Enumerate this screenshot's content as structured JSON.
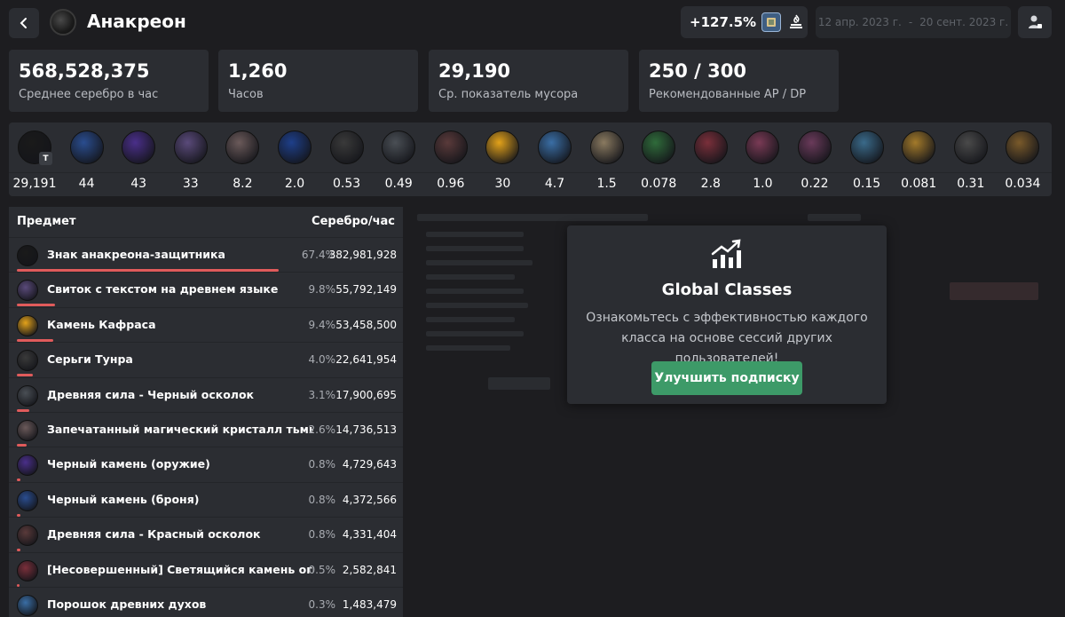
{
  "header": {
    "back_icon": "chevron-left-icon",
    "title": "Анакреон",
    "change_percent": "+127.5%",
    "date_from": "12 апр. 2023 г.",
    "date_separator": "-",
    "date_to": "20 сент. 2023 г."
  },
  "stats": [
    {
      "value": "568,528,375",
      "label": "Среднее серебро в час"
    },
    {
      "value": "1,260",
      "label": "Часов"
    },
    {
      "value": "29,190",
      "label": "Ср. показатель мусора"
    },
    {
      "value": "250 / 300",
      "label": "Рекомендованные AP / DP"
    }
  ],
  "strip": {
    "badge": "T",
    "items": [
      {
        "value": "29,191",
        "color": "#1a1a1a"
      },
      {
        "value": "44",
        "color": "#2a4d8f"
      },
      {
        "value": "43",
        "color": "#4a2f8a"
      },
      {
        "value": "33",
        "color": "#5a4a7a"
      },
      {
        "value": "8.2",
        "color": "#6b5a5a"
      },
      {
        "value": "2.0",
        "color": "#1e3f8a"
      },
      {
        "value": "0.53",
        "color": "#3a3a3a"
      },
      {
        "value": "0.49",
        "color": "#4a4f55"
      },
      {
        "value": "0.96",
        "color": "#5a3a3a"
      },
      {
        "value": "30",
        "color": "#e3a21a"
      },
      {
        "value": "4.7",
        "color": "#3a6ea5"
      },
      {
        "value": "1.5",
        "color": "#8a7a60"
      },
      {
        "value": "0.078",
        "color": "#2f6b3a"
      },
      {
        "value": "2.8",
        "color": "#7a2f3a"
      },
      {
        "value": "1.0",
        "color": "#7a3a55"
      },
      {
        "value": "0.22",
        "color": "#6a3a5a"
      },
      {
        "value": "0.15",
        "color": "#3a6a8a"
      },
      {
        "value": "0.081",
        "color": "#a37a2a"
      },
      {
        "value": "0.31",
        "color": "#4a4a4a"
      },
      {
        "value": "0.034",
        "color": "#7a5a2a"
      }
    ]
  },
  "table": {
    "headers": {
      "item": "Предмет",
      "value": "Серебро/час"
    },
    "bar_color": "#e05b5b",
    "rows": [
      {
        "name": "Знак анакреона-защитника",
        "pct": "67.4%",
        "value": "382,981,928",
        "share": 67.4,
        "color": "#1a1a1a"
      },
      {
        "name": "Свиток с текстом на древнем языке",
        "pct": "9.8%",
        "value": "55,792,149",
        "share": 9.8,
        "color": "#5a4a7a"
      },
      {
        "name": "Камень Кафраса",
        "pct": "9.4%",
        "value": "53,458,500",
        "share": 9.4,
        "color": "#e3a21a"
      },
      {
        "name": "Серьги Тунра",
        "pct": "4.0%",
        "value": "22,641,954",
        "share": 4.0,
        "color": "#3a3a3a"
      },
      {
        "name": "Древняя сила - Черный осколок",
        "pct": "3.1%",
        "value": "17,900,695",
        "share": 3.1,
        "color": "#4a4f55"
      },
      {
        "name": "Запечатанный магический кристалл тьмы",
        "pct": "2.6%",
        "value": "14,736,513",
        "share": 2.6,
        "color": "#6b5a5a"
      },
      {
        "name": "Черный камень (оружие)",
        "pct": "0.8%",
        "value": "4,729,643",
        "share": 0.8,
        "color": "#4a2f8a"
      },
      {
        "name": "Черный камень (броня)",
        "pct": "0.8%",
        "value": "4,372,566",
        "share": 0.8,
        "color": "#2a4d8f"
      },
      {
        "name": "Древняя сила - Красный осколок",
        "pct": "0.8%",
        "value": "4,331,404",
        "share": 0.8,
        "color": "#5a3a3a"
      },
      {
        "name": "[Несовершенный] Светящийся камень огня",
        "pct": "0.5%",
        "value": "2,582,841",
        "share": 0.5,
        "color": "#7a2f3a"
      },
      {
        "name": "Порошок древних духов",
        "pct": "0.3%",
        "value": "1,483,479",
        "share": 0.3,
        "color": "#3a6ea5"
      }
    ]
  },
  "overlay": {
    "icon": "chart-growth-icon",
    "title": "Global Classes",
    "description": "Ознакомьтесь с эффективностью каждого класса на основе сессий других пользователей!",
    "button": "Улучшить подписку",
    "button_color": "#3d9a68"
  }
}
